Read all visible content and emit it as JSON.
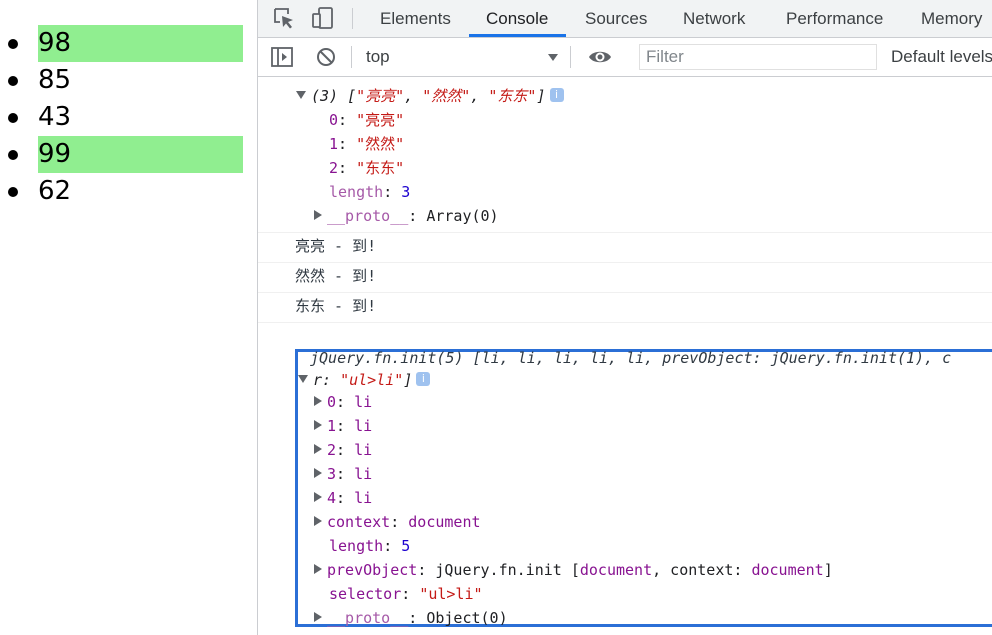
{
  "page": {
    "items": [
      "98",
      "85",
      "43",
      "99",
      "62"
    ],
    "highlight_color": "#90ee90"
  },
  "devtools": {
    "tabs": [
      "Elements",
      "Console",
      "Sources",
      "Network",
      "Performance",
      "Memory"
    ],
    "active_tab": "Console",
    "icons": [
      "inspect-element-icon",
      "device-toolbar-icon",
      "sidebar-toggle-icon",
      "clear-console-icon",
      "live-expression-eye-icon"
    ],
    "context": "top",
    "filter_placeholder": "Filter",
    "levels_label": "Default levels",
    "accent": "#1a73e8"
  },
  "console": {
    "array_header": {
      "count": "(3)",
      "open": "[",
      "items": [
        "\"亮亮\"",
        "\"然然\"",
        "\"东东\""
      ],
      "sep": ", ",
      "close": "]"
    },
    "array_entries": [
      {
        "key": "0",
        "value": "\"亮亮\""
      },
      {
        "key": "1",
        "value": "\"然然\""
      },
      {
        "key": "2",
        "value": "\"东东\""
      }
    ],
    "array_length": {
      "key": "length",
      "value": "3"
    },
    "array_proto": {
      "key": "__proto__",
      "value": "Array(0)"
    },
    "logs": [
      "亮亮 - 到!",
      "然然 - 到!",
      "东东 - 到!"
    ],
    "jquery": {
      "header_line1": "jQuery.fn.init(5) [li, li, li, li, li, prevObject: jQuery.fn.init(1), c",
      "header_line2_key": "r: ",
      "header_line2_val": "\"ul>li\"",
      "header_line2_close": "]",
      "entries": [
        {
          "key": "0",
          "value": "li"
        },
        {
          "key": "1",
          "value": "li"
        },
        {
          "key": "2",
          "value": "li"
        },
        {
          "key": "3",
          "value": "li"
        },
        {
          "key": "4",
          "value": "li"
        }
      ],
      "context": {
        "key": "context",
        "value": "document"
      },
      "length": {
        "key": "length",
        "value": "5"
      },
      "prevObject": {
        "key": "prevObject",
        "value_a": "jQuery.fn.init [",
        "value_b": "document",
        "value_c": ", context: ",
        "value_d": "document",
        "value_e": "]"
      },
      "selector": {
        "key": "selector",
        "value": "\"ul>li\""
      },
      "proto": {
        "key": "__proto__",
        "value": "Object(0)"
      },
      "box_color": "#2b6fd6"
    },
    "colon": ": "
  }
}
